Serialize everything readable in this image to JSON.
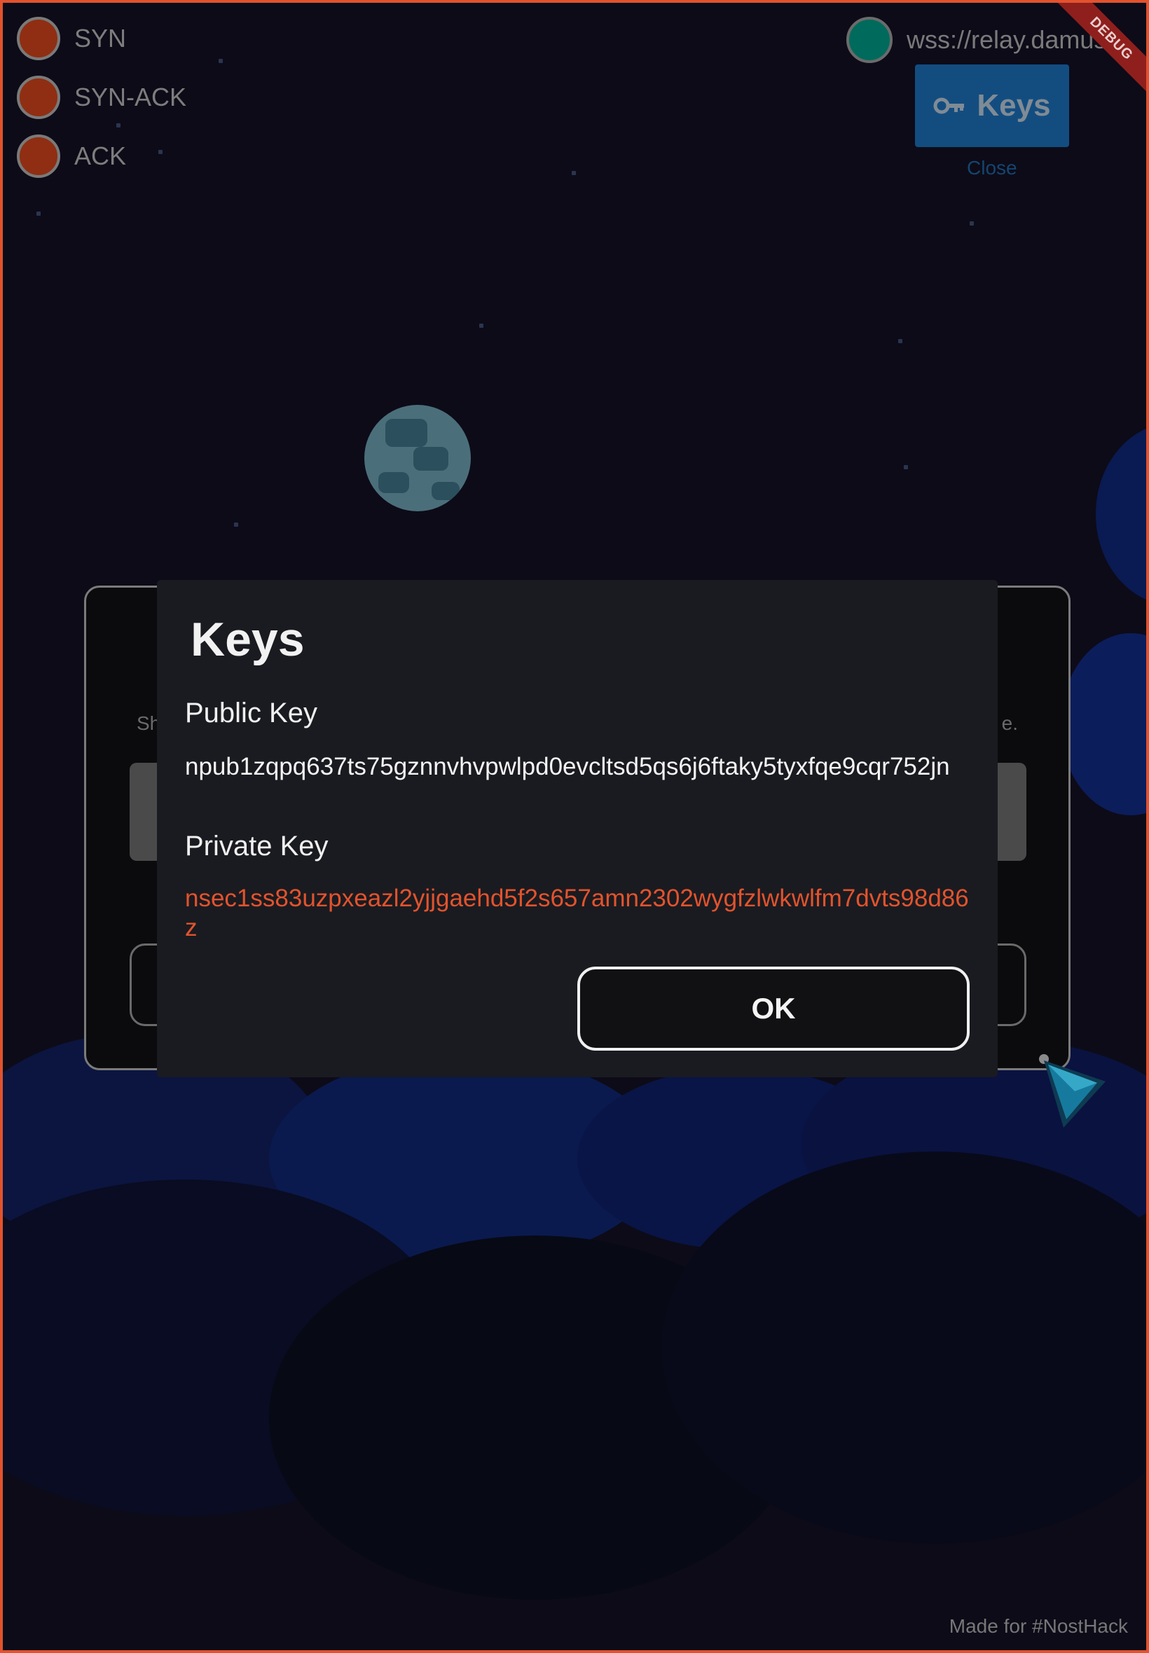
{
  "status_indicators": [
    {
      "label": "SYN",
      "color": "#8f2e12"
    },
    {
      "label": "SYN-ACK",
      "color": "#8f2e12"
    },
    {
      "label": "ACK",
      "color": "#8f2e12"
    }
  ],
  "relay": {
    "url": "wss://relay.damus.i",
    "status_color": "#006a5c"
  },
  "keys_button": {
    "label": "Keys",
    "icon": "key-icon"
  },
  "close_link": "Close",
  "debug_banner": "DEBUG",
  "background_card": {
    "text_left": "Sh",
    "text_right": "e."
  },
  "dialog": {
    "title": "Keys",
    "public_key_label": "Public Key",
    "public_key": "npub1zqpq637ts75gznnvhvpwlpd0evcltsd5qs6j6ftaky5tyxfqe9cqr752jn",
    "private_key_label": "Private Key",
    "private_key": "nsec1ss83uzpxeazl2yjjgaehd5f2s657amn2302wygfzlwkwlfm7dvts98d86z",
    "ok_label": "OK"
  },
  "footer": "Made for #NostHack",
  "colors": {
    "accent": "#e2532e",
    "key_button": "#134d80",
    "dialog_bg": "#1a1b20"
  }
}
